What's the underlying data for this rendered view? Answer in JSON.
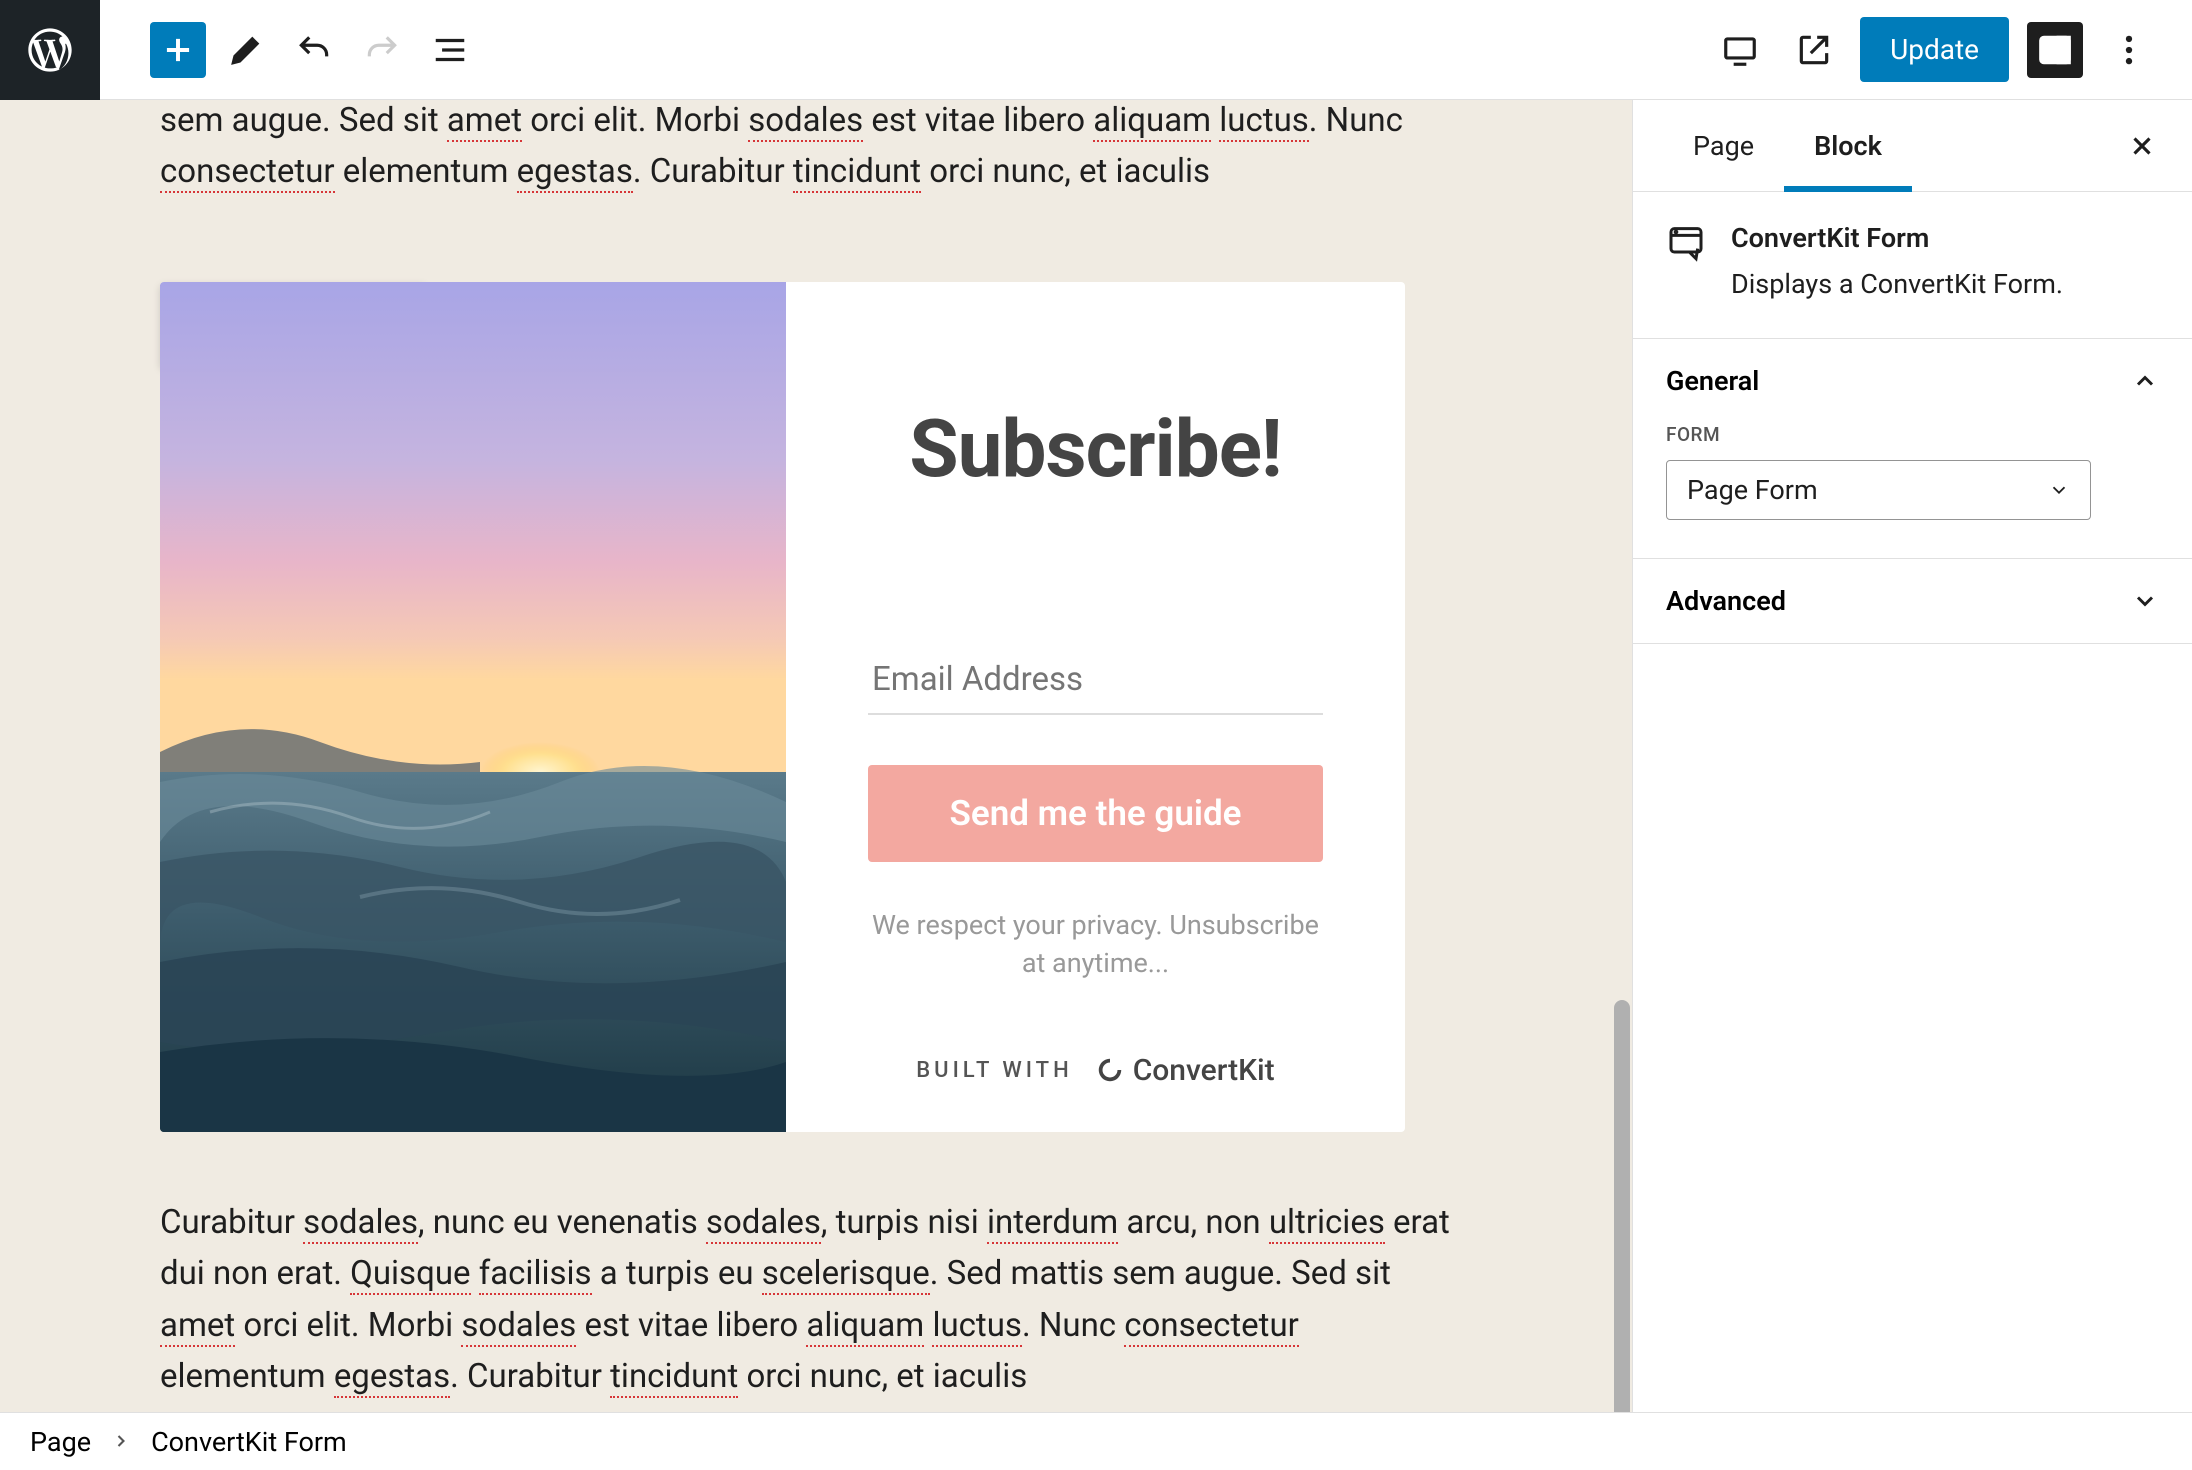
{
  "toolbar": {
    "update_label": "Update"
  },
  "canvas": {
    "para1_fragments": [
      "sem augue. Sed sit ",
      "amet",
      " orci elit. Morbi ",
      "sodales",
      " est vitae libero ",
      "aliquam",
      " ",
      "luctus",
      ". Nunc ",
      "consectetur",
      " elementum ",
      "egestas",
      ". Curabitur ",
      "tincidunt",
      " orci nunc, et iaculis"
    ],
    "para2_fragments": [
      "Curabitur ",
      "sodales",
      ", nunc eu venenatis ",
      "sodales",
      ", turpis nisi ",
      "interdum",
      " arcu, non ",
      "ultricies",
      " erat dui non erat. ",
      "Quisque",
      " ",
      "facilisis",
      " a turpis eu ",
      "scelerisque",
      ". Sed mattis sem augue. Sed sit ",
      "amet",
      " orci elit. Morbi ",
      "sodales",
      " est vitae libero ",
      "aliquam",
      " ",
      "luctus",
      ". Nunc ",
      "consectetur",
      " elementum ",
      "egestas",
      ". Curabitur ",
      "tincidunt",
      " orci nunc, et iaculis"
    ]
  },
  "form_block": {
    "title": "Subscribe!",
    "email_placeholder": "Email Address",
    "button_label": "Send me the guide",
    "privacy": "We respect your privacy. Unsubscribe at anytime...",
    "built_with_label": "BUILT WITH",
    "brand": "ConvertKit"
  },
  "sidebar": {
    "tabs": {
      "page": "Page",
      "block": "Block"
    },
    "block_card": {
      "title": "ConvertKit Form",
      "description": "Displays a ConvertKit Form."
    },
    "panels": {
      "general": {
        "title": "General",
        "form_label": "FORM",
        "form_value": "Page Form"
      },
      "advanced": {
        "title": "Advanced"
      }
    }
  },
  "breadcrumbs": {
    "root": "Page",
    "current": "ConvertKit Form"
  }
}
